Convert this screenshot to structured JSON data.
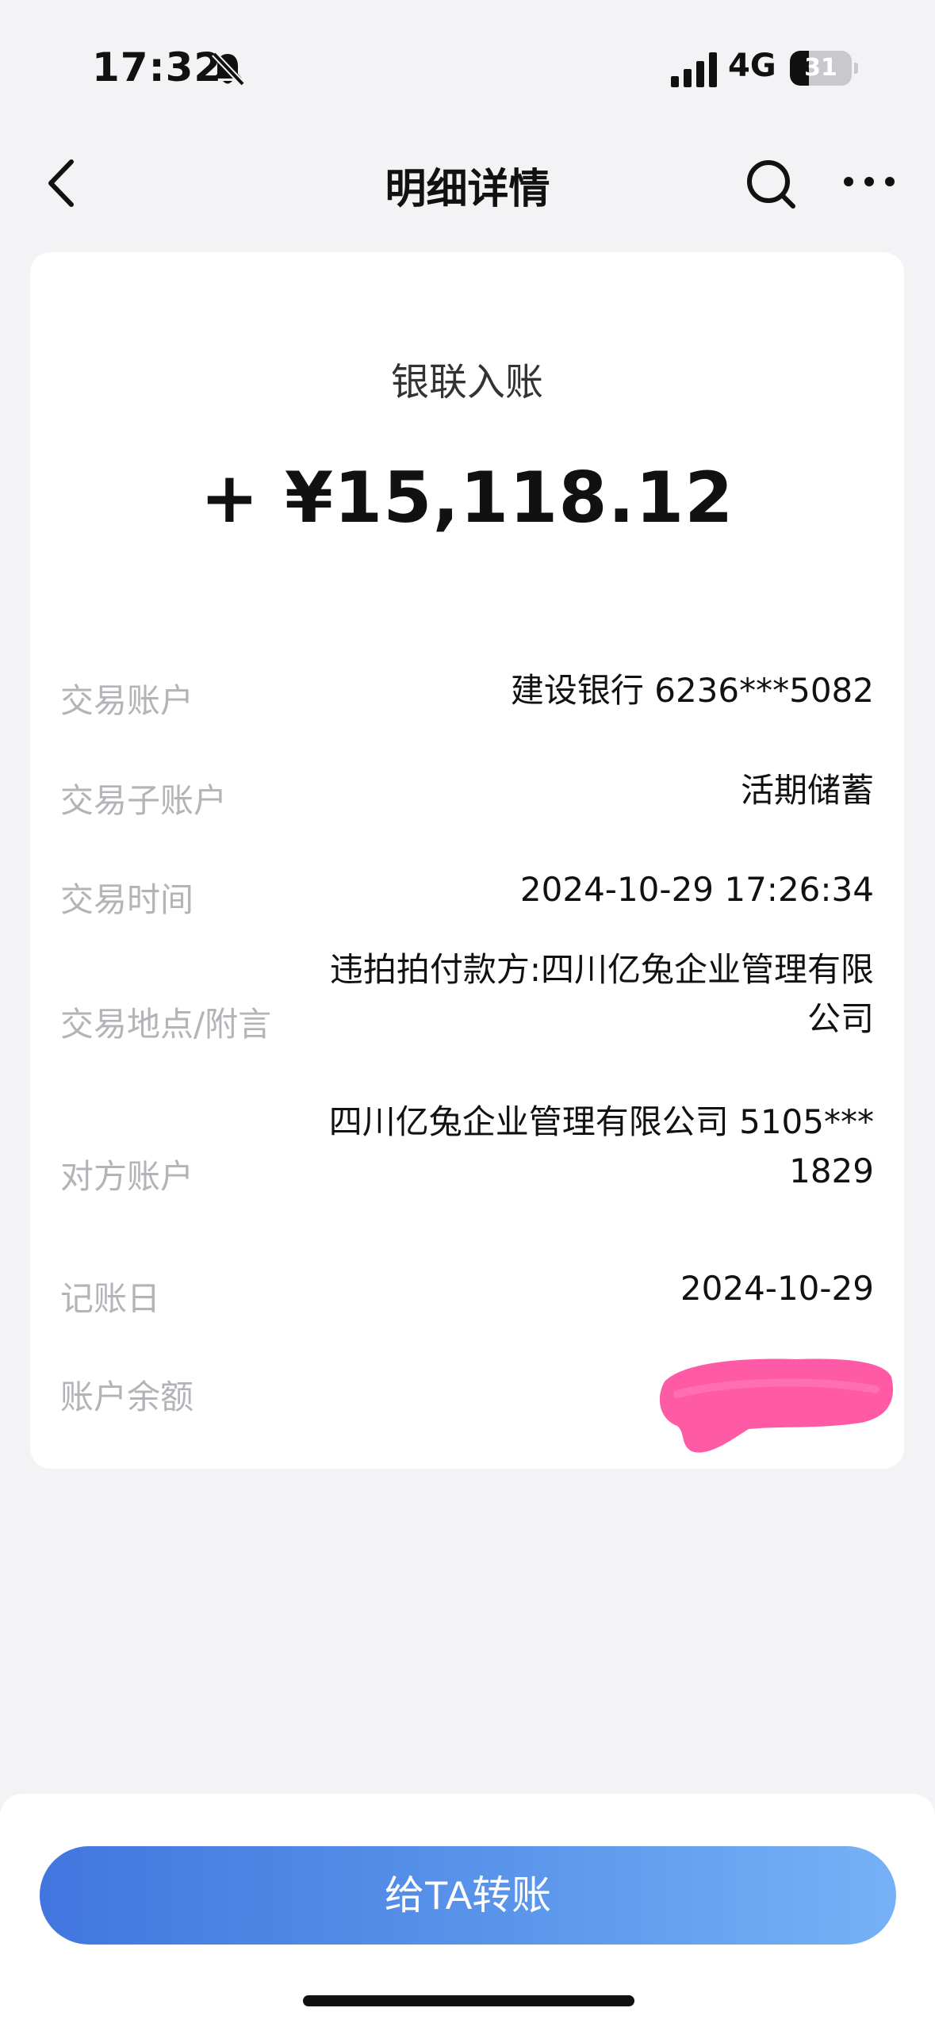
{
  "status_bar": {
    "time": "17:32",
    "network": "4G",
    "battery_level": "31",
    "battery_fraction": 0.31
  },
  "nav": {
    "title": "明细详情",
    "icons": [
      "chevron-left-icon",
      "search-icon",
      "more-icon"
    ]
  },
  "transaction": {
    "type": "银联入账",
    "amount": "+ ¥15,118.12"
  },
  "details": {
    "rows": [
      {
        "label": "交易账户",
        "value": "建设银行 6236***5082"
      },
      {
        "label": "交易子账户",
        "value": "活期储蓄"
      },
      {
        "label": "交易时间",
        "value": "2024-10-29 17:26:34"
      },
      {
        "label": "交易地点/附言",
        "value_line1": "违拍拍付款方:四川亿兔企业管理有限",
        "value_line2": "公司"
      },
      {
        "label": "对方账户",
        "value_line1": "四川亿兔企业管理有限公司 5105***",
        "value_line2": "1829"
      },
      {
        "label": "记账日",
        "value": "2024-10-29"
      },
      {
        "label": "账户余额",
        "value": ""
      }
    ]
  },
  "actions": {
    "transfer_label": "给TA转账"
  },
  "colors": {
    "background": "#f3f3f5",
    "card": "#ffffff",
    "label_gray": "#b3b3b8",
    "button_start": "#4276df",
    "button_end": "#76b1f6",
    "redaction_pink": "#ff5aa5"
  }
}
